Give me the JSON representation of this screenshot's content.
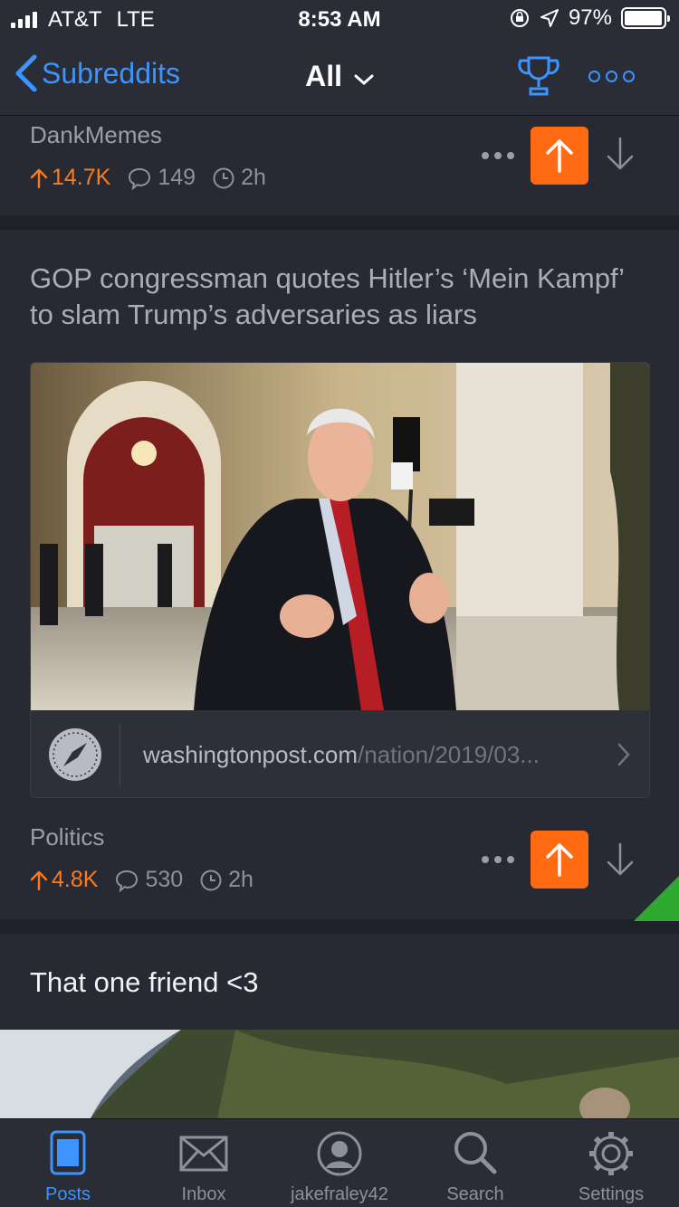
{
  "status_bar": {
    "carrier": "AT&T",
    "network": "LTE",
    "time": "8:53 AM",
    "battery": "97%",
    "battery_level": 0.97
  },
  "nav": {
    "back_label": "Subreddits",
    "title": "All",
    "icons": [
      "trophy-icon",
      "more-icon"
    ]
  },
  "posts": [
    {
      "subreddit": "DankMemes",
      "score": "14.7K",
      "comments": "149",
      "age": "2h",
      "upvoted": true
    },
    {
      "title": "GOP congressman quotes Hitler’s ‘Mein Kampf’ to slam Trump’s adversaries as liars",
      "link_domain": "washingtonpost.com",
      "link_path": "/nation/2019/03...",
      "subreddit": "Politics",
      "score": "4.8K",
      "comments": "530",
      "age": "2h",
      "upvoted": true
    },
    {
      "title": "That one friend <3"
    }
  ],
  "tabs": [
    {
      "label": "Posts",
      "icon": "posts-icon",
      "active": true
    },
    {
      "label": "Inbox",
      "icon": "envelope-icon",
      "active": false
    },
    {
      "label": "jakefraley42",
      "icon": "user-icon",
      "active": false
    },
    {
      "label": "Search",
      "icon": "search-icon",
      "active": false
    },
    {
      "label": "Settings",
      "icon": "gear-icon",
      "active": false
    }
  ],
  "colors": {
    "accent": "#3b94ff",
    "upvote": "#ff6a13",
    "background": "#1f2128",
    "card": "#282a33"
  }
}
